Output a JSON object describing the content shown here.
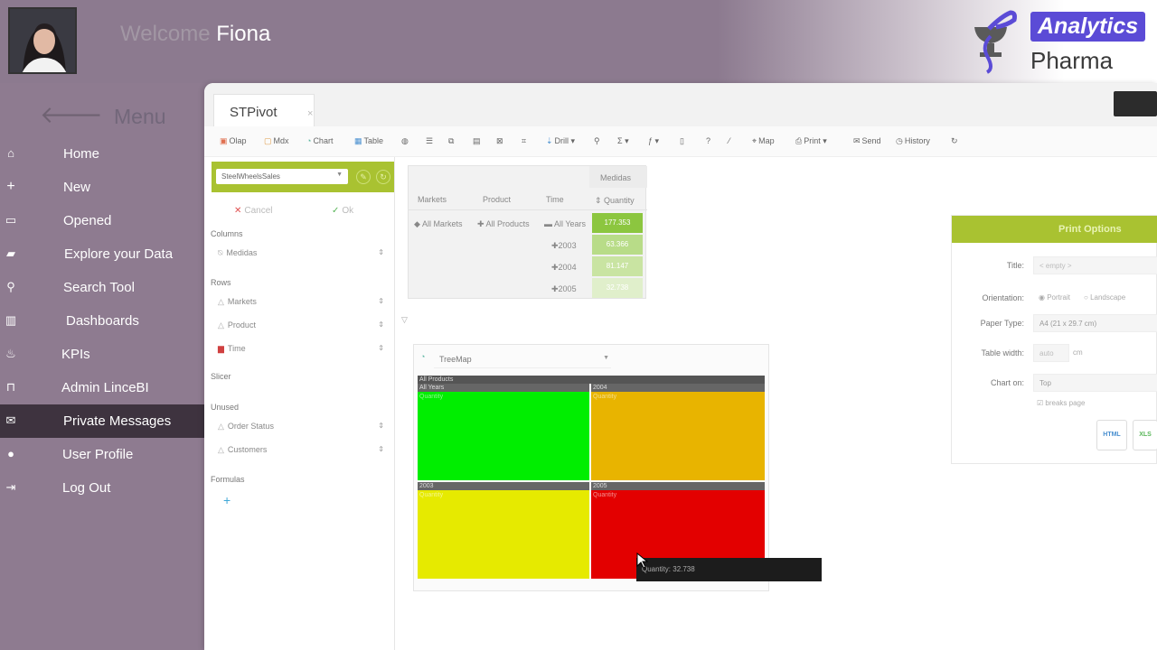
{
  "header": {
    "welcome_text": "Welcome ",
    "user_name": "Fiona",
    "logo_badge": "Analytics",
    "logo_sub": "Pharma"
  },
  "sidebar": {
    "menu_title": "Menu",
    "items": [
      {
        "label": "Home",
        "icon": "home-icon"
      },
      {
        "label": "New",
        "icon": "plus-icon"
      },
      {
        "label": "Opened",
        "icon": "window-icon"
      },
      {
        "label": "Explore your Data",
        "icon": "folder-open-icon"
      },
      {
        "label": "Search Tool",
        "icon": "search-icon"
      },
      {
        "label": "Dashboards",
        "icon": "bar-chart-icon"
      },
      {
        "label": "KPIs",
        "icon": "flame-icon"
      },
      {
        "label": "Admin LinceBI",
        "icon": "unlock-icon"
      },
      {
        "label": "Private Messages",
        "icon": "envelope-icon",
        "active": true
      },
      {
        "label": "User Profile",
        "icon": "user-icon"
      },
      {
        "label": "Log Out",
        "icon": "sign-out-icon"
      }
    ]
  },
  "tab": {
    "label": "STPivot",
    "close": "×"
  },
  "toolbar": {
    "olap": "Olap",
    "mdx": "Mdx",
    "chart": "Chart",
    "table": "Table",
    "drill": "Drill",
    "map": "Map",
    "print": "Print",
    "send": "Send",
    "history": "History"
  },
  "config": {
    "cube": "SteelWheelsSales",
    "cancel": "Cancel",
    "ok": "Ok",
    "sections": {
      "columns": "Columns",
      "rows": "Rows",
      "slicer": "Slicer",
      "unused": "Unused",
      "formulas": "Formulas"
    },
    "columns_fields": [
      "Medidas"
    ],
    "rows_fields": [
      "Markets",
      "Product",
      "Time"
    ],
    "unused_fields": [
      "Order Status",
      "Customers"
    ]
  },
  "pivot": {
    "measures_header": "Medidas",
    "col_markets": "Markets",
    "col_product": "Product",
    "col_time": "Time",
    "col_quantity": "Quantity",
    "row_markets": "All Markets",
    "row_product": "All Products",
    "row_years": "All Years",
    "years": [
      "2003",
      "2004",
      "2005"
    ],
    "total_value": "177.353",
    "year_values": [
      "63.366",
      "81.147",
      "32.738"
    ]
  },
  "treemap": {
    "chart_type": "TreeMap",
    "root_label": "All Products",
    "all_years_label": "All Years",
    "measure_label": "Quantity",
    "cells": [
      {
        "label": "All Years",
        "color": "#00ee00"
      },
      {
        "label": "2004",
        "color": "#e8b400"
      },
      {
        "label": "2003",
        "color": "#e6ea00"
      },
      {
        "label": "2005",
        "color": "#e30000"
      }
    ],
    "tooltip": "Quantity: 32.738"
  },
  "print_options": {
    "title": "Print Options",
    "title_label": "Title:",
    "title_placeholder": "< empty >",
    "orientation_label": "Orientation:",
    "portrait": "Portrait",
    "landscape": "Landscape",
    "paper_label": "Paper Type:",
    "paper_value": "A4 (21 x 29.7 cm)",
    "table_width_label": "Table width:",
    "table_width_value": "auto",
    "table_width_unit": "cm",
    "chart_on_label": "Chart on:",
    "chart_on_value": "Top",
    "breaks_page": "breaks page",
    "html_btn": "HTML",
    "xls_btn": "XLS"
  },
  "colors": {
    "sidebar_bg": "#8e7b90",
    "active_item": "#3e333f",
    "accent_green": "#a9c231",
    "logo_purple": "#5b4bd6"
  }
}
